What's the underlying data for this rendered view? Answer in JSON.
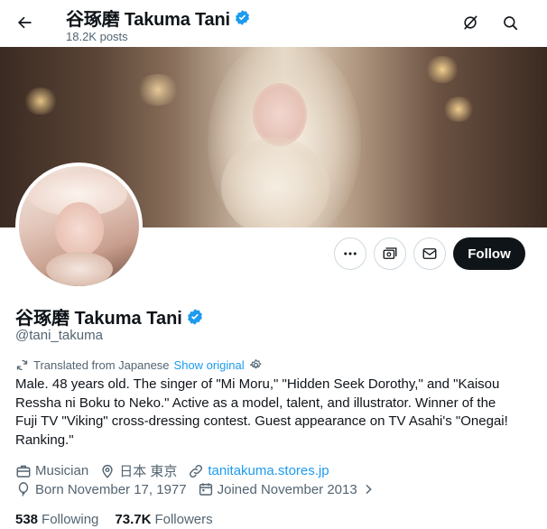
{
  "header": {
    "name": "谷琢磨 Takuma Tani",
    "posts": "18.2K posts"
  },
  "actions": {
    "follow_label": "Follow"
  },
  "profile": {
    "name": "谷琢磨 Takuma Tani",
    "handle": "@tani_takuma",
    "translated_label": "Translated from Japanese",
    "show_original_label": "Show original",
    "bio": "Male. 48 years old. The singer of \"Mi Moru,\" \"Hidden Seek Dorothy,\" and \"Kaisou Ressha ni Boku to Neko.\" Active as a model, talent, and illustrator. Winner of the Fuji TV \"Viking\" cross-dressing contest. Guest appearance on TV Asahi's \"Onegai! Ranking.\"",
    "category": "Musician",
    "location": "日本 東京",
    "website": "tanitakuma.stores.jp",
    "born": "Born November 17, 1977",
    "joined": "Joined November 2013"
  },
  "stats": {
    "following_count": "538",
    "following_label": "Following",
    "followers_count": "73.7K",
    "followers_label": "Followers"
  },
  "colors": {
    "accent": "#1d9bf0",
    "text": "#0f1419",
    "secondary": "#536471",
    "border": "#cfd9de"
  }
}
